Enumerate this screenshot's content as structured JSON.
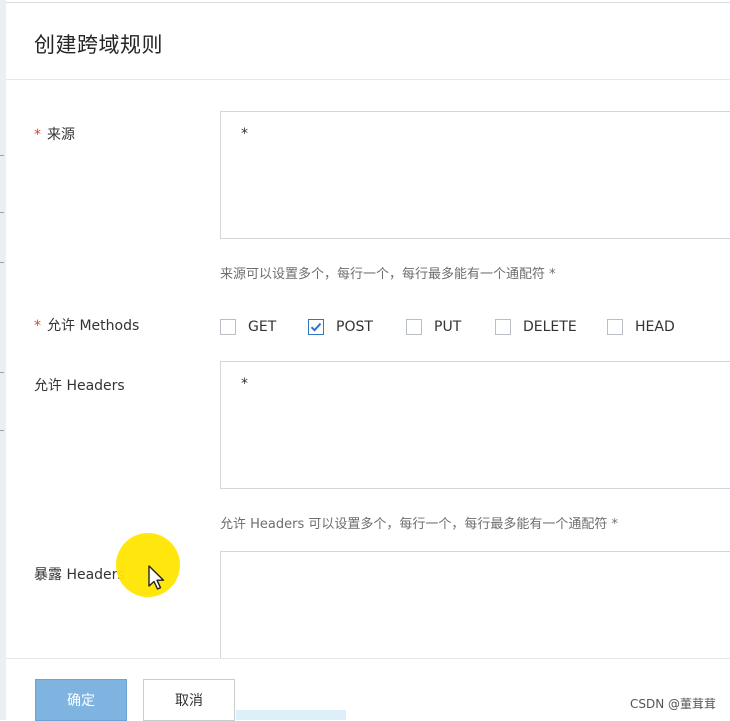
{
  "dialog": {
    "title": "创建跨域规则"
  },
  "form": {
    "origin": {
      "required_mark": "*",
      "label": "来源",
      "value": "*",
      "hint": "来源可以设置多个，每行一个，每行最多能有一个通配符 *"
    },
    "methods": {
      "required_mark": "*",
      "label": "允许 Methods",
      "options": [
        {
          "label": "GET",
          "checked": false
        },
        {
          "label": "POST",
          "checked": true
        },
        {
          "label": "PUT",
          "checked": false
        },
        {
          "label": "DELETE",
          "checked": false
        },
        {
          "label": "HEAD",
          "checked": false
        }
      ]
    },
    "allow_headers": {
      "label": "允许 Headers",
      "value": "*",
      "hint": "允许 Headers 可以设置多个，每行一个，每行最多能有一个通配符 *"
    },
    "expose_headers": {
      "label": "暴露 Headers",
      "value": ""
    }
  },
  "footer": {
    "confirm_label": "确定",
    "cancel_label": "取消"
  },
  "watermark": "CSDN @董茸茸",
  "colors": {
    "accent": "#2d77c4",
    "required": "#e0402a",
    "confirm_button": "#7fb4e0",
    "cursor_highlight": "#ffe600"
  }
}
